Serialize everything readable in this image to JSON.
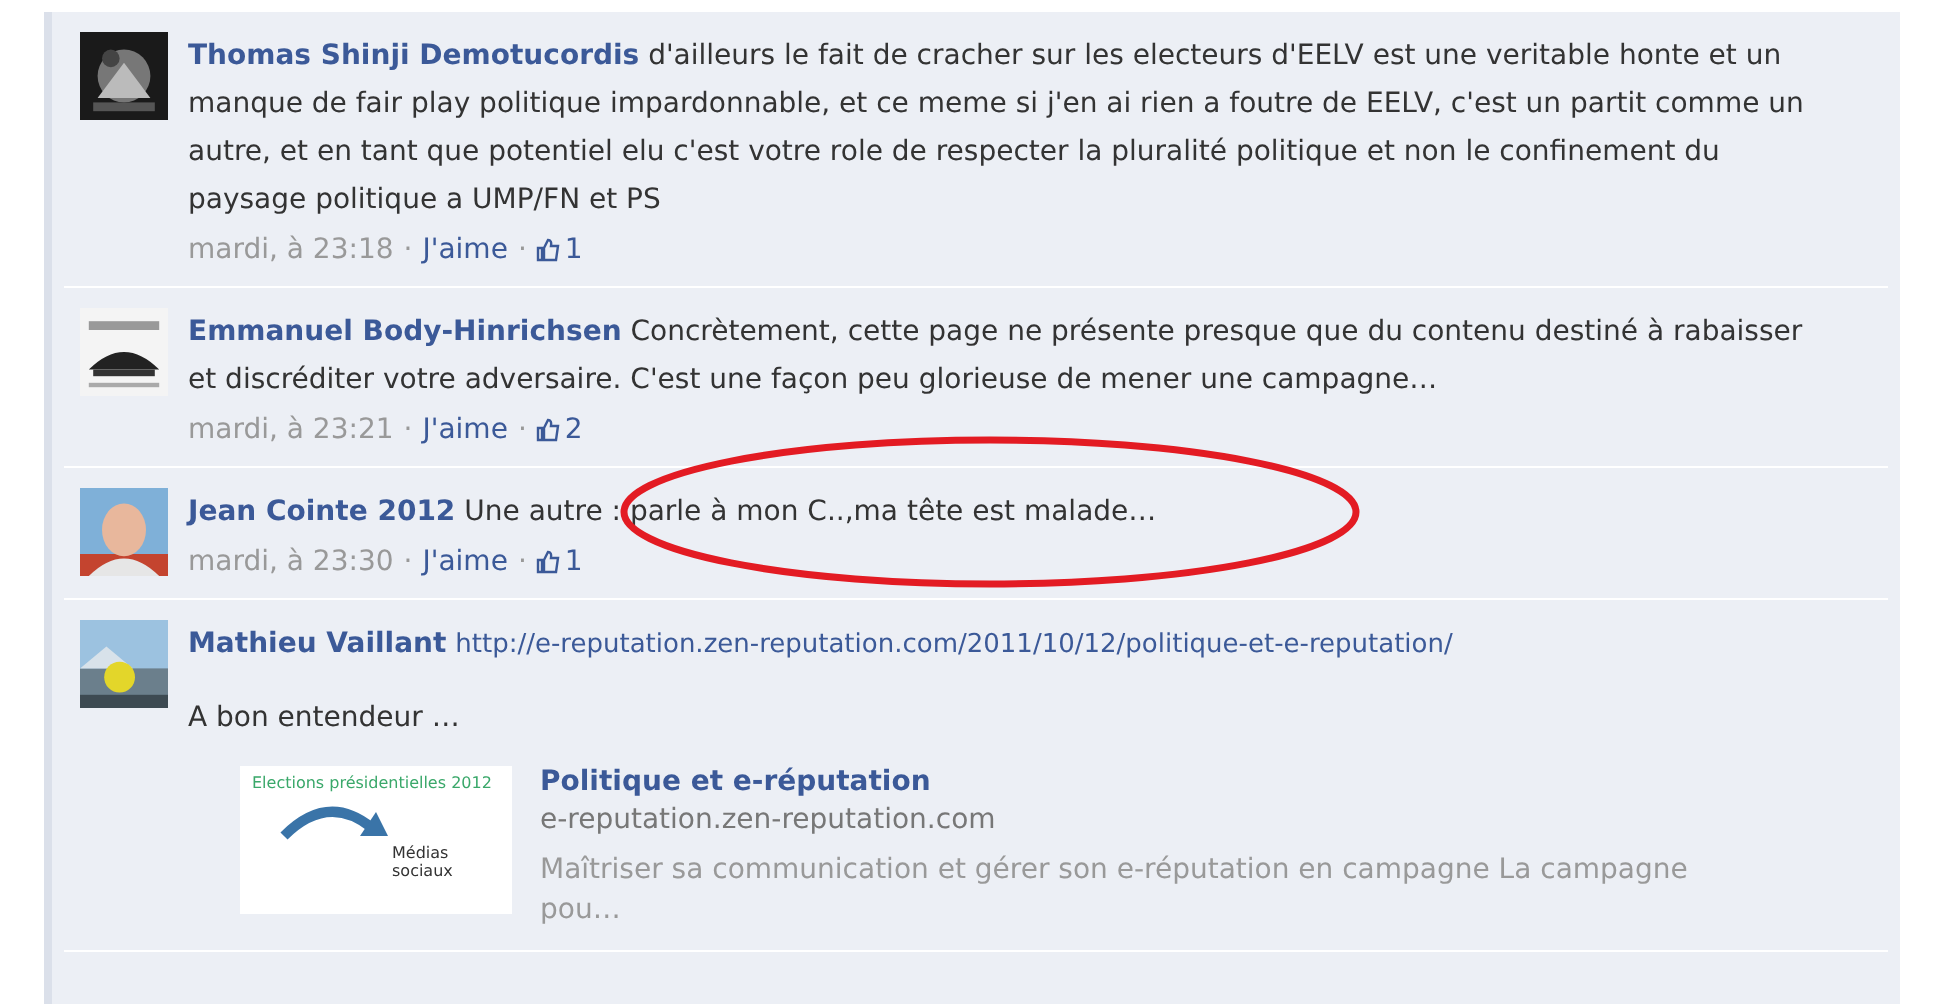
{
  "comments": [
    {
      "author": "Thomas Shinji Demotucordis",
      "text": "d'ailleurs le fait de cracher sur les electeurs d'EELV est une veritable honte et un manque de fair play politique impardonnable, et ce meme si j'en ai rien a foutre de EELV, c'est un partit comme un autre, et en tant que potentiel elu c'est votre role de respecter la pluralité politique et non le confinement du paysage politique a UMP/FN et PS",
      "time": "mardi, à 23:18",
      "like_label": "J'aime",
      "like_count": "1",
      "separators": [
        "·",
        "·"
      ]
    },
    {
      "author": "Emmanuel Body-Hinrichsen",
      "text": "Concrètement, cette page ne présente presque que du contenu destiné à rabaisser et discréditer votre adversaire. C'est une façon peu glorieuse de mener une campagne…",
      "time": "mardi, à 23:21",
      "like_label": "J'aime",
      "like_count": "2",
      "separators": [
        "·",
        "·"
      ]
    },
    {
      "author": "Jean Cointe 2012",
      "text": "Une autre : parle à mon C..,ma tête est malade…",
      "time": "mardi, à 23:30",
      "like_label": "J'aime",
      "like_count": "1",
      "separators": [
        "·",
        "·"
      ],
      "annotation": {
        "kind": "ellipse",
        "color": "#e31b23"
      }
    },
    {
      "author": "Mathieu Vaillant",
      "link": "http://e-reputation.zen-reputation.com/2011/10/12/politique-et-e-reputation/",
      "extra": "A bon entendeur …",
      "attachment": {
        "thumb_title": "Elections présidentielles 2012",
        "thumb_label": "Médias sociaux",
        "title": "Politique et e-réputation",
        "domain": "e-reputation.zen-reputation.com",
        "description": "Maîtriser sa communication et gérer son e-réputation en campagne La campagne pou…"
      }
    }
  ]
}
